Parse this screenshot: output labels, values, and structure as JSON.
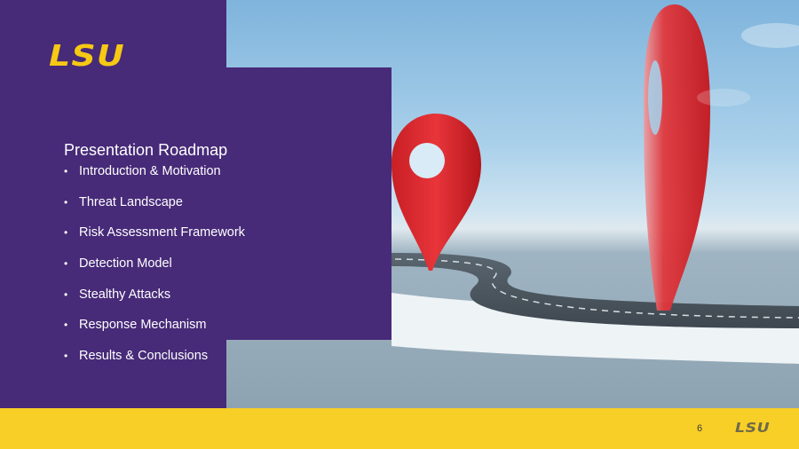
{
  "brand": {
    "logo_text": "LSU",
    "purple": "#472a78",
    "gold": "#f6c914",
    "footer_yellow": "#f8cf26"
  },
  "slide": {
    "title": "Presentation Roadmap",
    "agenda": [
      "Introduction & Motivation",
      "Threat Landscape",
      "Risk Assessment Framework",
      "Detection Model",
      "Stealthy Attacks",
      "Response Mechanism",
      "Results & Conclusions"
    ],
    "bullet": "•"
  },
  "footer": {
    "page_number": "6",
    "logo_text": "LSU"
  },
  "image": {
    "description_icon": "map-pin-road-photo"
  }
}
